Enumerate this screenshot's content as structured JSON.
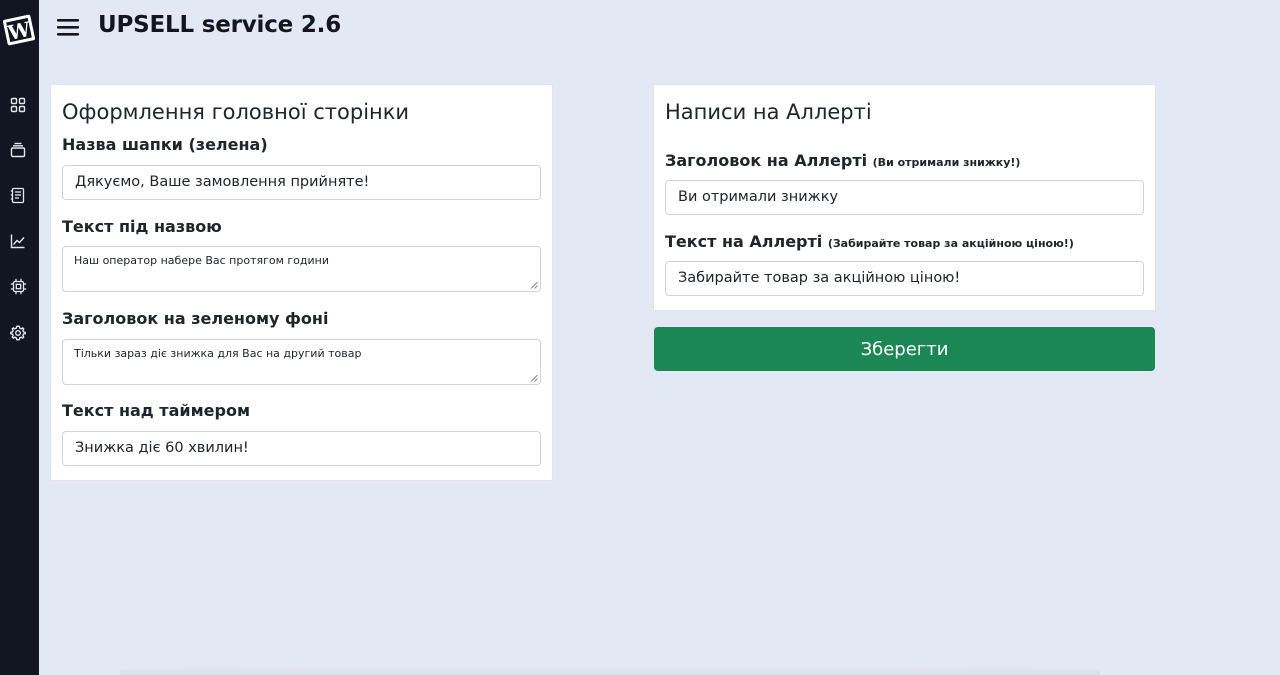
{
  "app": {
    "title": "UPSELL service 2.6"
  },
  "sidebar": {
    "icons": [
      "logo-w-icon",
      "dashboard-grid-icon",
      "layers-icon",
      "document-list-icon",
      "chart-line-icon",
      "chip-icon",
      "gear-icon"
    ]
  },
  "main_page": {
    "title": "Оформлення головної сторінки",
    "header_name": {
      "label": "Назва шапки (зелена)",
      "value": "Дякуємо, Ваше замовлення прийняте!"
    },
    "subtitle_text": {
      "label": "Текст під назвою",
      "value": "Наш оператор набере Вас протягом години"
    },
    "green_heading": {
      "label": "Заголовок на зеленому фоні",
      "value": "Тільки зараз діє знижка для Вас на другий товар"
    },
    "timer_text": {
      "label": "Текст над таймером",
      "value": "Знижка діє 60 хвилин!"
    }
  },
  "alert": {
    "title": "Написи на Аллерті",
    "heading": {
      "label": "Заголовок на Аллерті",
      "hint": "(Ви отримали знижку!)",
      "value": "Ви отримали знижку"
    },
    "text": {
      "label": "Текст на Аллерті",
      "hint": "(Забирайте товар за акційною ціною!)",
      "value": "Забирайте товар за акційною ціною!"
    }
  },
  "actions": {
    "save_label": "Зберегти"
  },
  "colors": {
    "sidebar": "#121522",
    "background": "#e3e8f5",
    "save_button": "#1b8754"
  }
}
